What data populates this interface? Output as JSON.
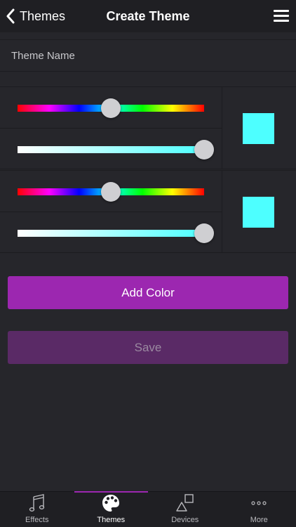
{
  "nav": {
    "back_label": "Themes",
    "title": "Create Theme"
  },
  "theme_name": {
    "placeholder": "Theme Name",
    "value": ""
  },
  "colors": [
    {
      "hue": 0.5,
      "saturation": 1.0,
      "swatch": "#4dffff"
    },
    {
      "hue": 0.5,
      "saturation": 1.0,
      "swatch": "#4dffff"
    }
  ],
  "buttons": {
    "add_color": "Add Color",
    "save": "Save"
  },
  "tabs": [
    {
      "label": "Effects",
      "icon": "music-note-icon",
      "active": false
    },
    {
      "label": "Themes",
      "icon": "palette-icon",
      "active": true
    },
    {
      "label": "Devices",
      "icon": "devices-icon",
      "active": false
    },
    {
      "label": "More",
      "icon": "more-icon",
      "active": false
    }
  ],
  "theme": {
    "accent": "#9c27b0",
    "background": "#26262b"
  }
}
